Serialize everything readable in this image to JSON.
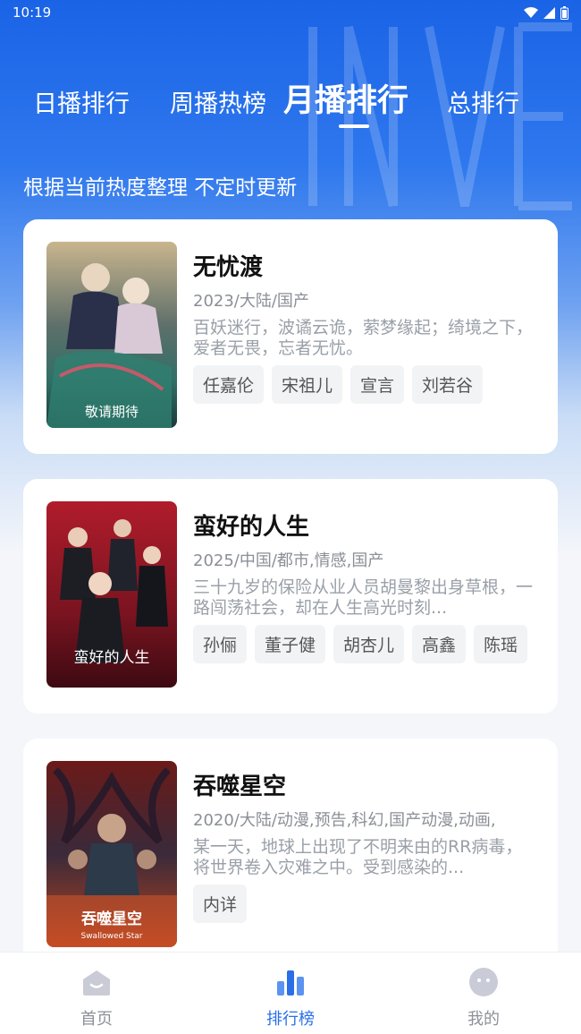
{
  "status": {
    "time": "10:19"
  },
  "tabs": [
    {
      "label": "日播排行"
    },
    {
      "label": "周播热榜"
    },
    {
      "label": "月播排行"
    },
    {
      "label": "总排行"
    }
  ],
  "subtitle": "根据当前热度整理 不定时更新",
  "cards": [
    {
      "title": "无忧渡",
      "meta": "2023/大陆/国产",
      "desc": "百妖迷行，波谲云诡，萦梦缘起；绮境之下，爱者无畏，忘者无忧。",
      "poster_caption": "敬请期待",
      "tags": [
        "任嘉伦",
        "宋祖儿",
        "宣言",
        "刘若谷"
      ]
    },
    {
      "title": "蛮好的人生",
      "meta": "2025/中国/都市,情感,国产",
      "desc": "三十九岁的保险从业人员胡曼黎出身草根，一路闯荡社会，却在人生高光时刻...",
      "poster_caption": "蛮好的人生",
      "tags": [
        "孙俪",
        "董子健",
        "胡杏儿",
        "高鑫",
        "陈瑶"
      ]
    },
    {
      "title": "吞噬星空",
      "meta": "2020/大陆/动漫,预告,科幻,国产动漫,动画,",
      "desc": "某一天，地球上出现了不明来由的RR病毒，将世界卷入灾难之中。受到感染的...",
      "poster_caption": "吞噬星空",
      "poster_caption_en": "Swallowed Star",
      "tags": [
        "内详"
      ]
    }
  ],
  "nav": [
    {
      "label": "首页",
      "icon": "home-icon"
    },
    {
      "label": "排行榜",
      "icon": "ranking-icon"
    },
    {
      "label": "我的",
      "icon": "profile-icon"
    }
  ],
  "colors": {
    "accent": "#2b6fe8",
    "hero": "#1a63e6"
  }
}
